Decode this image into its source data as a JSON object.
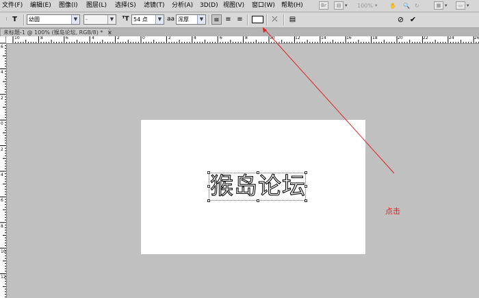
{
  "menubar": {
    "items": [
      "文件(F)",
      "编辑(E)",
      "图像(I)",
      "图层(L)",
      "选择(S)",
      "滤镜(T)",
      "分析(A)",
      "3D(D)",
      "视图(V)",
      "窗口(W)",
      "帮助(H)"
    ],
    "zoom": "100%"
  },
  "options": {
    "font_family": "幼圆",
    "font_style": "-",
    "font_size": "54 点",
    "antialias_icon_label": "aa",
    "antialias": "浑厚"
  },
  "document": {
    "tab_title": "未标题-1 @ 100% (猴岛论坛, RGB/8) *",
    "close": "×",
    "canvas_text": "猴岛论坛"
  },
  "rulers": {
    "h_labels": [
      "10",
      "8",
      "6",
      "4",
      "2",
      "0",
      "2",
      "4",
      "6",
      "8",
      "10",
      "12",
      "14",
      "16",
      "18",
      "20",
      "22",
      "24",
      "26"
    ],
    "v_labels": [
      "6",
      "4",
      "2",
      "0",
      "2",
      "4",
      "6",
      "8",
      "10",
      "12"
    ]
  },
  "annotation": {
    "text": "点击",
    "color": "#e02020"
  },
  "colors": {
    "workspace": "#c0c0c0",
    "canvas": "#ffffff",
    "arrow": "#e02020"
  }
}
